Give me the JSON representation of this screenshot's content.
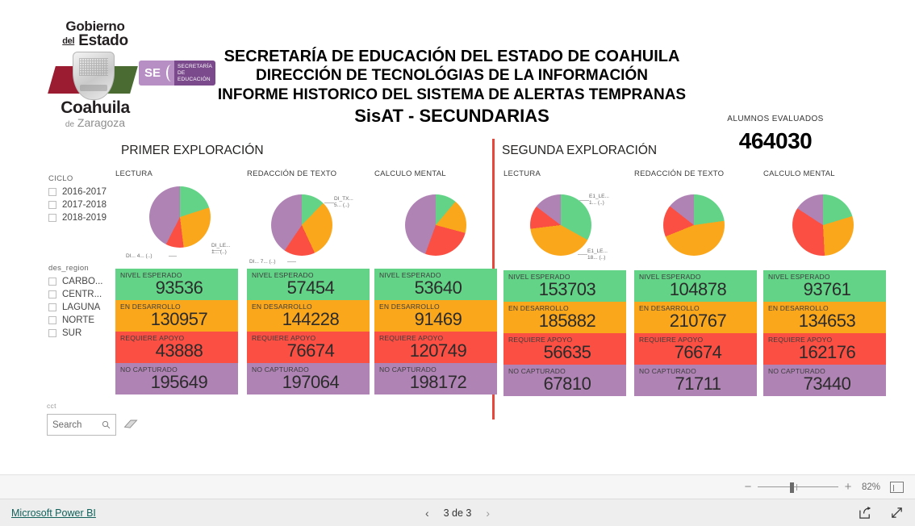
{
  "logo": {
    "gob_line1": "Gobierno",
    "gob_line2_prefix": "del",
    "gob_line2": "Estado",
    "state": "Coahuila",
    "state_sub_de": "de",
    "state_sub": "Zaragoza",
    "se_abbr": "SE",
    "se_line1": "SECRETARÍA",
    "se_line2": "DE EDUCACIÓN"
  },
  "header": {
    "line1": "SECRETARÍA DE EDUCACIÓN DEL ESTADO DE COAHUILA",
    "line2": "DIRECCIÓN DE TECNOLÓGIAS DE LA INFORMACIÓN",
    "line3": "INFORME HISTORICO DEL SISTEMA DE ALERTAS TEMPRANAS",
    "line4": "SisAT - SECUNDARIAS"
  },
  "kpi": {
    "label": "ALUMNOS EVALUADOS",
    "value": "464030"
  },
  "sections": {
    "first": "PRIMER EXPLORACIÓN",
    "second": "SEGUNDA EXPLORACIÓN"
  },
  "filters": [
    {
      "title": "CICLO",
      "name": "ciclo",
      "items": [
        {
          "label": "2016-2017",
          "checked": false
        },
        {
          "label": "2017-2018",
          "checked": false
        },
        {
          "label": "2018-2019",
          "checked": false
        }
      ]
    },
    {
      "title": "des_region",
      "name": "des-region",
      "items": [
        {
          "label": "CARBO...",
          "checked": false
        },
        {
          "label": "CENTR...",
          "checked": false
        },
        {
          "label": "LAGUNA",
          "checked": false
        },
        {
          "label": "NORTE",
          "checked": false
        },
        {
          "label": "SUR",
          "checked": false
        }
      ]
    }
  ],
  "search": {
    "label": "cct",
    "placeholder": "Search",
    "value": "",
    "search_icon": "search-icon",
    "eraser_icon": "eraser-icon"
  },
  "band_labels": {
    "nivel": "NIVEL ESPERADO",
    "desarrollo": "EN DESARROLLO",
    "apoyo": "REQUIERE APOYO",
    "no_capturado": "NO CAPTURADO"
  },
  "colors": {
    "green": "#62d387",
    "orange": "#fba71b",
    "red": "#fb4f43",
    "purple": "#b083b5",
    "divider": "#e8463a",
    "link": "#12625b"
  },
  "groups": [
    {
      "id": "e1-lectura",
      "title": "LECTURA",
      "exploration": "first",
      "nivel": "93536",
      "desarrollo": "130957",
      "apoyo": "43888",
      "no_capturado": "195649",
      "pie_labels": [
        {
          "l1": "DI_LE...",
          "l2": "1... (..)"
        },
        {
          "l1": "DI... 4... (..)",
          "l2": ""
        }
      ]
    },
    {
      "id": "e1-redaccion",
      "title": "REDACCIÓN DE TEXTO",
      "exploration": "first",
      "nivel": "57454",
      "desarrollo": "144228",
      "apoyo": "76674",
      "no_capturado": "197064",
      "pie_labels": [
        {
          "l1": "DI_TX...",
          "l2": "5... (..)"
        },
        {
          "l1": "DI... 7... (..)",
          "l2": ""
        }
      ]
    },
    {
      "id": "e1-calculo",
      "title": "CALCULO MENTAL",
      "exploration": "first",
      "nivel": "53640",
      "desarrollo": "91469",
      "apoyo": "120749",
      "no_capturado": "198172",
      "pie_labels": []
    },
    {
      "id": "e2-lectura",
      "title": "LECTURA",
      "exploration": "second",
      "nivel": "153703",
      "desarrollo": "185882",
      "apoyo": "56635",
      "no_capturado": "67810",
      "pie_labels": [
        {
          "l1": "E1_LE...",
          "l2": "1... (..)"
        },
        {
          "l1": "E1_LE...",
          "l2": "18... (..)"
        }
      ]
    },
    {
      "id": "e2-redaccion",
      "title": "REDACCIÓN DE TEXTO",
      "exploration": "second",
      "nivel": "104878",
      "desarrollo": "210767",
      "apoyo": "76674",
      "no_capturado": "71711",
      "pie_labels": []
    },
    {
      "id": "e2-calculo",
      "title": "CALCULO MENTAL",
      "exploration": "second",
      "nivel": "93761",
      "desarrollo": "134653",
      "apoyo": "162176",
      "no_capturado": "73440",
      "pie_labels": []
    }
  ],
  "chart_data": [
    {
      "type": "pie",
      "title": "LECTURA",
      "section": "PRIMER EXPLORACIÓN",
      "categories": [
        "NIVEL ESPERADO",
        "EN DESARROLLO",
        "REQUIERE APOYO",
        "NO CAPTURADO"
      ],
      "values": [
        93536,
        130957,
        43888,
        195649
      ],
      "colors": [
        "#62d387",
        "#fba71b",
        "#fb4f43",
        "#b083b5"
      ],
      "legend": "off"
    },
    {
      "type": "pie",
      "title": "REDACCIÓN DE TEXTO",
      "section": "PRIMER EXPLORACIÓN",
      "categories": [
        "NIVEL ESPERADO",
        "EN DESARROLLO",
        "REQUIERE APOYO",
        "NO CAPTURADO"
      ],
      "values": [
        57454,
        144228,
        76674,
        197064
      ],
      "colors": [
        "#62d387",
        "#fba71b",
        "#fb4f43",
        "#b083b5"
      ],
      "legend": "off"
    },
    {
      "type": "pie",
      "title": "CALCULO MENTAL",
      "section": "PRIMER EXPLORACIÓN",
      "categories": [
        "NIVEL ESPERADO",
        "EN DESARROLLO",
        "REQUIERE APOYO",
        "NO CAPTURADO"
      ],
      "values": [
        53640,
        91469,
        120749,
        198172
      ],
      "colors": [
        "#62d387",
        "#fba71b",
        "#fb4f43",
        "#b083b5"
      ],
      "legend": "off"
    },
    {
      "type": "pie",
      "title": "LECTURA",
      "section": "SEGUNDA EXPLORACIÓN",
      "categories": [
        "NIVEL ESPERADO",
        "EN DESARROLLO",
        "REQUIERE APOYO",
        "NO CAPTURADO"
      ],
      "values": [
        153703,
        185882,
        56635,
        67810
      ],
      "colors": [
        "#62d387",
        "#fba71b",
        "#fb4f43",
        "#b083b5"
      ],
      "legend": "off"
    },
    {
      "type": "pie",
      "title": "REDACCIÓN DE TEXTO",
      "section": "SEGUNDA EXPLORACIÓN",
      "categories": [
        "NIVEL ESPERADO",
        "EN DESARROLLO",
        "REQUIERE APOYO",
        "NO CAPTURADO"
      ],
      "values": [
        104878,
        210767,
        76674,
        71711
      ],
      "colors": [
        "#62d387",
        "#fba71b",
        "#fb4f43",
        "#b083b5"
      ],
      "legend": "off"
    },
    {
      "type": "pie",
      "title": "CALCULO MENTAL",
      "section": "SEGUNDA EXPLORACIÓN",
      "categories": [
        "NIVEL ESPERADO",
        "EN DESARROLLO",
        "REQUIERE APOYO",
        "NO CAPTURADO"
      ],
      "values": [
        93761,
        134653,
        162176,
        73440
      ],
      "colors": [
        "#62d387",
        "#fba71b",
        "#fb4f43",
        "#b083b5"
      ],
      "legend": "off"
    }
  ],
  "zoombar": {
    "minus": "−",
    "plus": "+",
    "percent": "82%",
    "fit_icon": "fit-to-page-icon"
  },
  "statusbar": {
    "brand": "Microsoft Power BI",
    "prev_icon": "chevron-left-icon",
    "next_icon": "chevron-right-icon",
    "page": "3 de 3",
    "share_icon": "share-icon",
    "fullscreen_icon": "fullscreen-icon"
  }
}
